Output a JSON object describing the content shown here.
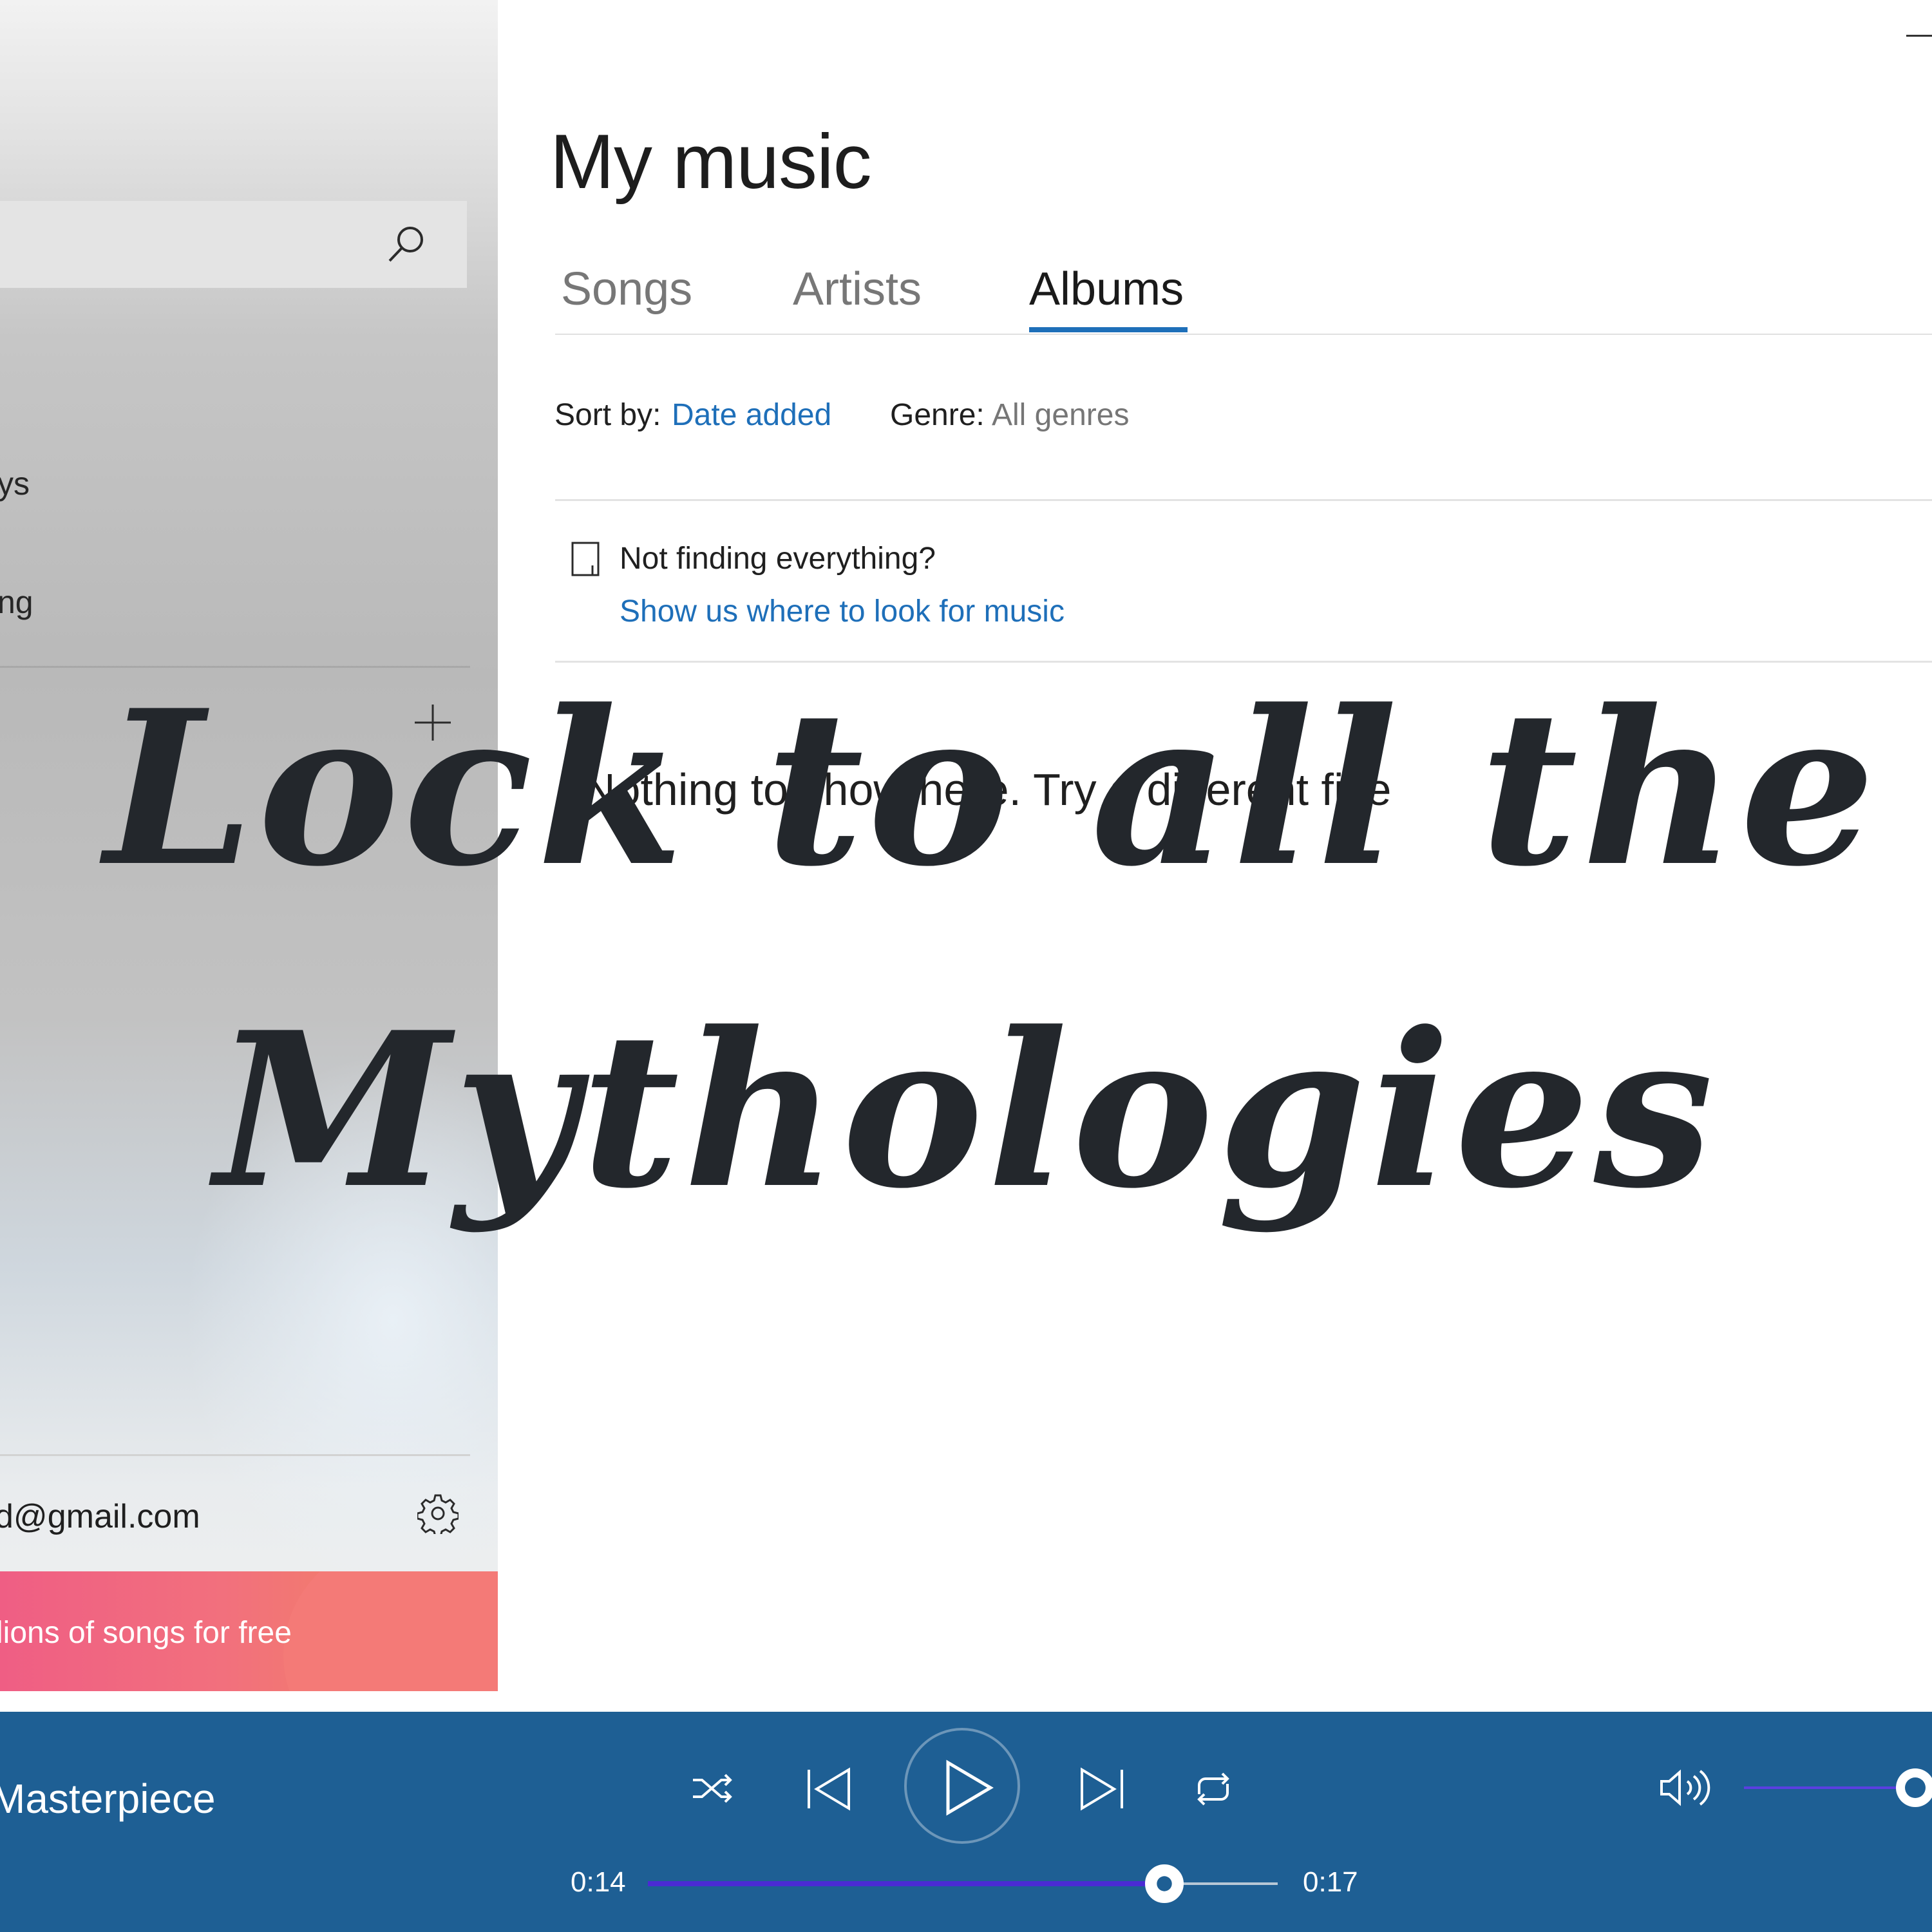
{
  "sidebar": {
    "search": {
      "placeholder": ""
    },
    "nav_fragments": [
      "ys",
      "ng"
    ],
    "account_email": "d@gmail.com",
    "promo_text": "lions of songs for free"
  },
  "main": {
    "title": "My music",
    "tabs": [
      {
        "label": "Songs",
        "active": false
      },
      {
        "label": "Artists",
        "active": false
      },
      {
        "label": "Albums",
        "active": true
      }
    ],
    "sort": {
      "label": "Sort by:",
      "value": "Date added"
    },
    "genre": {
      "label": "Genre:",
      "value": "All genres"
    },
    "hint": {
      "title": "Not finding everything?",
      "link": "Show us where to look for music"
    },
    "empty_message": "Nothing to show here. Try a different filte"
  },
  "player": {
    "track_title": "Masterpiece",
    "elapsed": "0:14",
    "duration": "0:17",
    "progress_fraction": 0.82,
    "volume_fraction": 1.0,
    "buttons": [
      "shuffle-icon",
      "previous-icon",
      "play-icon",
      "next-icon",
      "repeat-icon",
      "volume-icon"
    ]
  },
  "overlay": {
    "line1": "Lock to all the",
    "line2": "Mythologies"
  },
  "colors": {
    "accent": "#1e6fb9",
    "player_bg": "#1e5f94",
    "slider_fill": "#4a2bd3",
    "overlay_text": "#23272c"
  }
}
